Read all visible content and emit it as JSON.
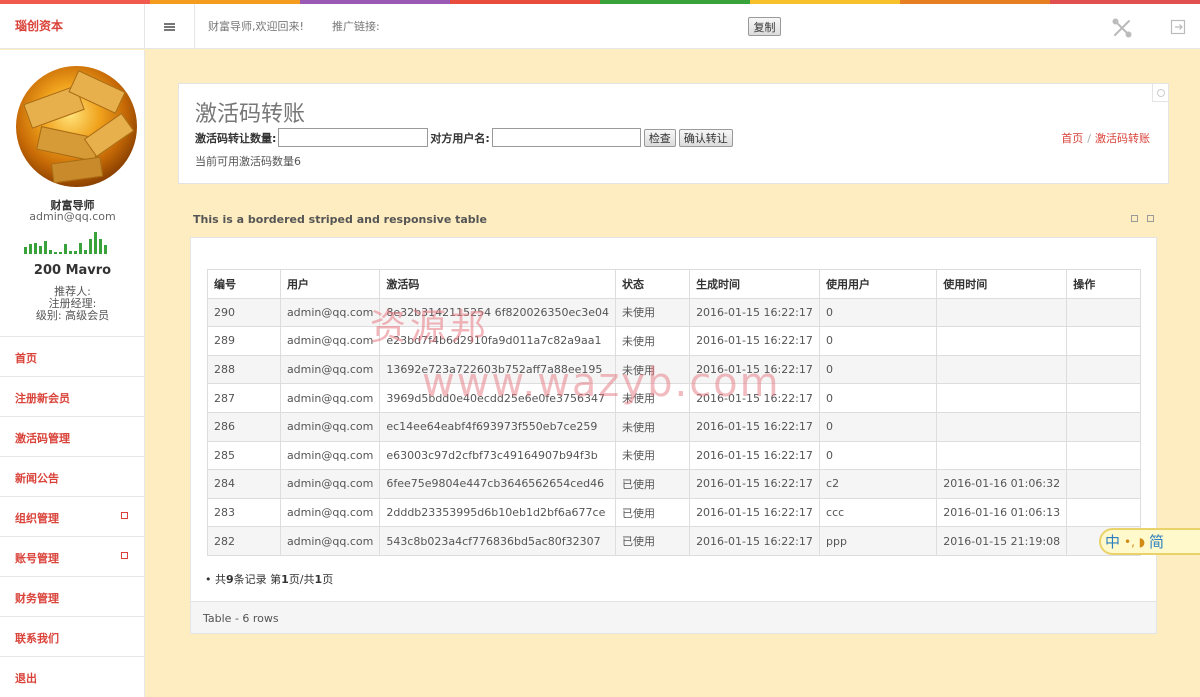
{
  "colors": {
    "accent": "#d9433a",
    "background": "#fdedc1",
    "rainbow": [
      "#f05a4f",
      "#f39c1f",
      "#9b59b6",
      "#e74c3c",
      "#3aa23a",
      "#f6c12a",
      "#e67e22",
      "#e05050"
    ]
  },
  "header": {
    "brand": "瑙创资本",
    "welcome": "财富导师,欢迎回来!",
    "promo_label": "推广链接:",
    "copy_label": "复制",
    "tools_icon": "tools-icon",
    "exit_icon": "exit-icon"
  },
  "user": {
    "name": "财富导师",
    "email": "admin@qq.com",
    "balance": "200 Mavro",
    "referrer": "推荐人:",
    "manager": "注册经理:",
    "level": "级别: 高级会员",
    "spark_values": [
      6,
      9,
      10,
      7,
      12,
      4,
      2,
      2,
      9,
      3,
      3,
      10,
      4,
      14,
      20,
      14,
      8
    ]
  },
  "sidebar": {
    "items": [
      {
        "label": "首页",
        "sub": false
      },
      {
        "label": "注册新会员",
        "sub": false
      },
      {
        "label": "激活码管理",
        "sub": false
      },
      {
        "label": "新闻公告",
        "sub": false
      },
      {
        "label": "组织管理",
        "sub": true
      },
      {
        "label": "账号管理",
        "sub": true
      },
      {
        "label": "财务管理",
        "sub": false
      },
      {
        "label": "联系我们",
        "sub": false
      },
      {
        "label": "退出",
        "sub": false
      }
    ]
  },
  "page": {
    "title": "激活码转账",
    "qty_label": "激活码转让数量:",
    "qty_value": "",
    "target_label": "对方用户名:",
    "target_value": "",
    "check_label": "检查",
    "confirm_label": "确认转让",
    "available": "当前可用激活码数量6",
    "breadcrumb": {
      "home": "首页",
      "sep": "/",
      "current": "激活码转账"
    }
  },
  "table": {
    "caption": "This is a bordered striped and responsive table",
    "columns": [
      "编号",
      "用户",
      "激活码",
      "状态",
      "生成时间",
      "使用用户",
      "使用时间",
      "操作"
    ],
    "rows": [
      [
        "290",
        "admin@qq.com",
        "8e32b3142115254 6f820026350ec3e04",
        "未使用",
        "2016-01-15 16:22:17",
        "0",
        "",
        ""
      ],
      [
        "289",
        "admin@qq.com",
        "e23bd7f4b6d2910fa9d011a7c82a9aa1",
        "未使用",
        "2016-01-15 16:22:17",
        "0",
        "",
        ""
      ],
      [
        "288",
        "admin@qq.com",
        "13692e723a722603b752aff7a88ee195",
        "未使用",
        "2016-01-15 16:22:17",
        "0",
        "",
        ""
      ],
      [
        "287",
        "admin@qq.com",
        "3969d5bdd0e40ecdd25e6e0fe3756347",
        "未使用",
        "2016-01-15 16:22:17",
        "0",
        "",
        ""
      ],
      [
        "286",
        "admin@qq.com",
        "ec14ee64eabf4f693973f550eb7ce259",
        "未使用",
        "2016-01-15 16:22:17",
        "0",
        "",
        ""
      ],
      [
        "285",
        "admin@qq.com",
        "e63003c97d2cfbf73c49164907b94f3b",
        "未使用",
        "2016-01-15 16:22:17",
        "0",
        "",
        ""
      ],
      [
        "284",
        "admin@qq.com",
        "6fee75e9804e447cb3646562654ced46",
        "已使用",
        "2016-01-15 16:22:17",
        "c2",
        "2016-01-16 01:06:32",
        ""
      ],
      [
        "283",
        "admin@qq.com",
        "2dddb23353995d6b10eb1d2bf6a677ce",
        "已使用",
        "2016-01-15 16:22:17",
        "ccc",
        "2016-01-16 01:06:13",
        ""
      ],
      [
        "282",
        "admin@qq.com",
        "543c8b023a4cf776836bd5ac80f32307",
        "已使用",
        "2016-01-15 16:22:17",
        "ppp",
        "2016-01-15 21:19:08",
        ""
      ]
    ],
    "pager_prefix": "• 共",
    "pager_total": "9",
    "pager_mid": "条记录 第",
    "pager_page": "1",
    "pager_sep": "页/共",
    "pager_pages": "1",
    "pager_suffix": "页",
    "footer": "Table - 6 rows"
  },
  "watermark": {
    "line1": "资源邦",
    "line2": "www.wazyb.com"
  },
  "lang_widget": {
    "zh": "中",
    "dots": "•, ◗",
    "simp": "简"
  }
}
